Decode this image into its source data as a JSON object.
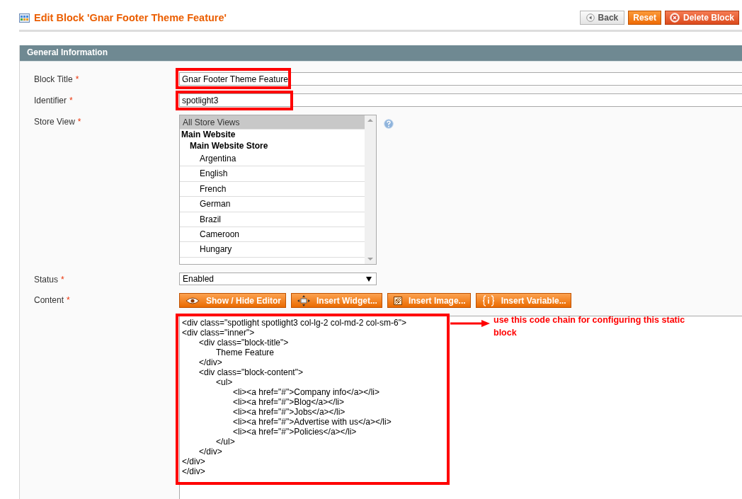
{
  "page": {
    "title": "Edit Block 'Gnar Footer Theme Feature'",
    "buttons": [
      {
        "label": "Back",
        "kind": "back"
      },
      {
        "label": "Reset",
        "kind": "reset"
      },
      {
        "label": "Delete Block",
        "kind": "delete"
      }
    ]
  },
  "section": {
    "title": "General Information"
  },
  "fields": [
    {
      "kind": "text",
      "label": "Block Title",
      "required_mark": "*",
      "value": "Gnar Footer Theme Feature",
      "highlighted": true
    },
    {
      "kind": "text",
      "label": "Identifier",
      "required_mark": "*",
      "value": "spotlight3",
      "highlighted": true
    },
    {
      "kind": "multiselect",
      "label": "Store View",
      "required_mark": "*",
      "options": [
        {
          "label": "All Store Views",
          "kind": "option",
          "selected": true
        },
        {
          "label": "Main Website",
          "kind": "website",
          "selected": false
        },
        {
          "label": "Main Website Store",
          "kind": "store",
          "selected": false
        },
        {
          "label": "Argentina",
          "kind": "option",
          "selected": false
        },
        {
          "label": "English",
          "kind": "option",
          "selected": false
        },
        {
          "label": "French",
          "kind": "option",
          "selected": false
        },
        {
          "label": "German",
          "kind": "option",
          "selected": false
        },
        {
          "label": "Brazil",
          "kind": "option",
          "selected": false
        },
        {
          "label": "Cameroon",
          "kind": "option",
          "selected": false
        },
        {
          "label": "Hungary",
          "kind": "option",
          "selected": false
        }
      ]
    },
    {
      "kind": "select",
      "label": "Status",
      "required_mark": "*",
      "value": "Enabled"
    },
    {
      "kind": "editor",
      "label": "Content",
      "required_mark": "*",
      "highlighted": true,
      "buttons": [
        {
          "label": "Show / Hide Editor",
          "kind": "toggle"
        },
        {
          "label": "Insert Widget...",
          "kind": "widget"
        },
        {
          "label": "Insert Image...",
          "kind": "image"
        },
        {
          "label": "Insert Variable...",
          "kind": "variable"
        }
      ],
      "value": "<div class=\"spotlight spotlight3 col-lg-2 col-md-2 col-sm-6\">\n<div class=\"inner\">\n\t<div class=\"block-title\">\n\t\tTheme Feature\n\t</div>\n\t<div class=\"block-content\">\n\t\t<ul>\n\t\t\t<li><a href=\"#\">Company info</a></li>\n\t\t\t<li><a href=\"#\">Blog</a></li>\n\t\t\t<li><a href=\"#\">Jobs</a></li>\n\t\t\t<li><a href=\"#\">Advertise with us</a></li>\n\t\t\t<li><a href=\"#\">Policies</a></li>\n\t\t</ul>\n\t</div>\n</div>\n</div>",
      "annotation": "use this code chain for configuring this static block"
    }
  ]
}
